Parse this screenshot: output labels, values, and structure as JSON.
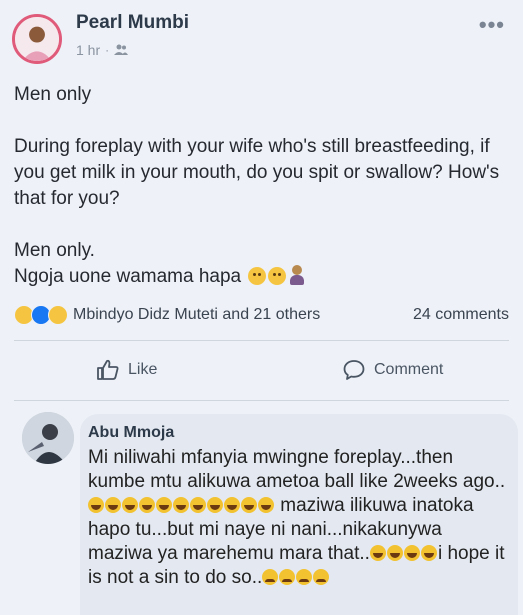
{
  "post": {
    "author": "Pearl Mumbi",
    "time": "1 hr",
    "separator": "·",
    "audience_icon": "friends-icon",
    "more_label": "•••",
    "line1": "Men only",
    "line2": "During foreplay with your wife who's still breastfeeding, if you get milk in your mouth, do you spit or swallow? How's that for you?",
    "line3a": "Men only.",
    "line3b": "Ngoja uone wamama hapa",
    "line3b_emoji": [
      "confused-face",
      "confused-face",
      "person-facepalming"
    ]
  },
  "reactions": {
    "icons": [
      "haha-reaction-icon",
      "like-reaction-icon",
      "wow-reaction-icon"
    ],
    "reactors": "Mbindyo Didz Muteti and 21 others",
    "comments": "24 comments"
  },
  "actions": {
    "like": "Like",
    "comment": "Comment"
  },
  "comment": {
    "author": "Abu Mmoja",
    "seg1": "Mi niliwahi mfanyia mwingne foreplay...then kumbe mtu alikuwa ametoa ball like 2weeks ago..",
    "emoji_run1": 11,
    "seg2": " maziwa ilikuwa inatoka hapo tu...but mi naye ni nani...nikakunywa maziwa ya marehemu mara that..",
    "emoji_run2": 4,
    "seg3": "i hope it is not a sin to do so..",
    "emoji_run3": 4
  },
  "colors": {
    "accent": "#1877f2",
    "avatar_ring": "#e05a7a",
    "background": "#eef2f8"
  }
}
